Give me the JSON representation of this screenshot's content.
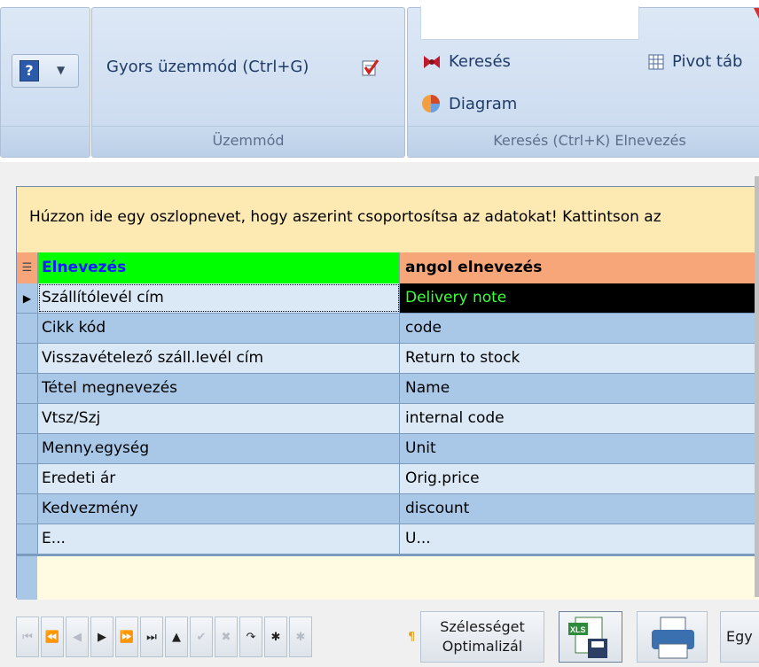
{
  "ribbon": {
    "group_mode": {
      "label": "Üzemmód",
      "quick_mode": "Gyors üzemmód (Ctrl+G)"
    },
    "group_search": {
      "label": "Keresés (Ctrl+K) Elnevezés",
      "search": "Keresés",
      "diagram": "Diagram",
      "pivot": "Pivot táb"
    }
  },
  "grid": {
    "group_hint": "Húzzon ide egy oszlopnevet, hogy aszerint csoportosítsa az adatokat! Kattintson az",
    "columns": [
      "Elnevezés",
      "angol elnevezés"
    ],
    "rows": [
      [
        "Szállítólevél cím",
        "Delivery note"
      ],
      [
        "Cikk kód",
        "code"
      ],
      [
        "Visszavételező száll.levél cím",
        "Return to stock"
      ],
      [
        "Tétel megnevezés",
        "Name"
      ],
      [
        "Vtsz/Szj",
        "internal code"
      ],
      [
        "Menny.egység",
        "Unit"
      ],
      [
        "Eredeti ár",
        "Orig.price"
      ],
      [
        "Kedvezmény",
        "discount"
      ],
      [
        "E...",
        "U..."
      ]
    ]
  },
  "navbar": {
    "width_button": "Szélességet Optimalizál",
    "width_line1": "Szélességet",
    "width_line2": "Optimalizál",
    "egy_button": "Egy"
  },
  "colors": {
    "header_green": "#00ff00",
    "header_orange": "#f7a679",
    "selected_text": "#3cff3c"
  }
}
